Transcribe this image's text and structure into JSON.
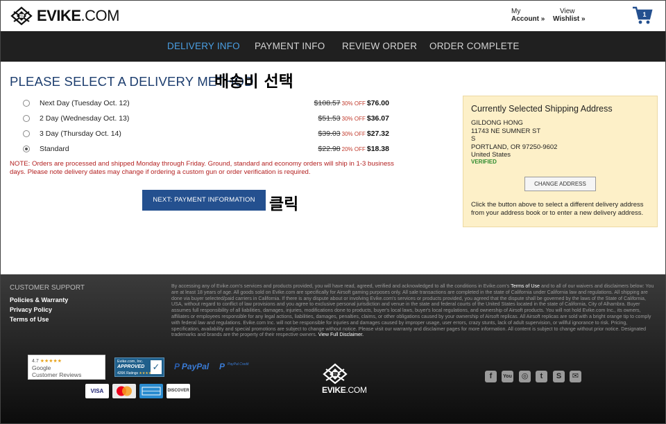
{
  "header": {
    "logo_text": "EVIKE",
    "logo_suffix": ".COM",
    "my_account_top": "My",
    "my_account_bottom": "Account »",
    "wishlist_top": "View",
    "wishlist_bottom": "Wishlist »",
    "cart_count": "1"
  },
  "nav": {
    "steps": [
      "DELIVERY INFO",
      "PAYMENT INFO",
      "REVIEW ORDER",
      "ORDER COMPLETE"
    ],
    "active_index": 0
  },
  "delivery": {
    "title": "PLEASE SELECT A DELIVERY METHOD",
    "korean_title": "배송비 선택",
    "options": [
      {
        "label": "Next Day (Tuesday Oct. 12)",
        "old_price": "$108.57",
        "discount": "30% OFF",
        "new_price": "$76.00",
        "selected": false
      },
      {
        "label": "2 Day (Wednesday Oct. 13)",
        "old_price": "$51.53",
        "discount": "30% OFF",
        "new_price": "$36.07",
        "selected": false
      },
      {
        "label": "3 Day (Thursday Oct. 14)",
        "old_price": "$39.03",
        "discount": "30% OFF",
        "new_price": "$27.32",
        "selected": false
      },
      {
        "label": "Standard",
        "old_price": "$22.98",
        "discount": "20% OFF",
        "new_price": "$18.38",
        "selected": true
      }
    ],
    "note": "NOTE: Orders are processed and shipped Monday through Friday. Ground, standard and economy orders will ship in 1-3 business days. Please note delivery dates may change if ordering a custom gun or order verification is required.",
    "next_button": "NEXT: PAYMENT INFORMATION",
    "korean_click": "클릭"
  },
  "address": {
    "title": "Currently Selected Shipping Address",
    "lines": [
      "GILDONG HONG",
      "11743 NE SUMNER ST",
      "S",
      "PORTLAND, OR 97250-9602",
      "United States"
    ],
    "status": "VERIFIED",
    "change_button": "CHANGE ADDRESS",
    "help": "Click the button above to select a different delivery address from your address book or to enter a new delivery address."
  },
  "footer": {
    "support_title": "CUSTOMER SUPPORT",
    "links": [
      "Policies & Warranty",
      "Privacy Policy",
      "Terms of Use"
    ],
    "legal_intro": "By accessing any of Evike.com's services and products provided, you will have read, agreed, verified and acknowledged to all the conditions in Evike.com's",
    "legal_terms": "Terms of Use",
    "legal_body": "and to all of our waivers and disclaimers below: You are at least 18 years of age. All goods sold on Evike.com are specifically for Airsoft gaming purposes only. All sale transactions are completed in the state of California under California law and regulations. All shipping are done via buyer selected/paid carriers in California. If there is any dispute about or involving Evike.com's services or products provided, you agreed that the dispute shall be governed by the laws of the State of California, USA, without regard to conflict of law provisions and you agree to exclusive personal jurisdiction and venue in the state and federal courts of the United States located in the state of California, City of Alhambra. Buyer assumes full responsibility of all liabilities, damages, injuries, modifications done to products, buyer's local laws, buyer's local regulations, and ownership of Airsoft products. You will not hold Evike.com Inc., its owners, affiliates or employees responsible for any legal actions, liabilities, damages, penalties, claims, or other obligations caused by your ownership of Airsoft replicas. All Airsoft replicas are sold with a bright orange tip to comply with federal law and regulations. Evike.com Inc. will not be responsible for injuries and damages caused by improper usage, user errors, crazy stunts, lack of adult supervision, or willful ignorance to risk. Pricing, specification, availability and special promotions are subject to change without notice. Please visit our warranty and disclaimer pages for more information. All content is subject to change without prior notice. Designated trademarks and brands are the property of their respective owners.",
    "legal_view": "View Full Disclaimer.",
    "google_rating": "4.7",
    "google_stars": "★★★★★",
    "google_line1": "Google",
    "google_line2": "Customer Reviews",
    "shopper_l1": "Evike.com, Inc.",
    "shopper_l2": "APPROVED",
    "shopper_l3": "426K Ratings",
    "shopper_stars": "★★★★★",
    "paypal": "PayPal",
    "paypal_credit": "PayPal Credit",
    "cards": [
      "VISA",
      "MC",
      "AMEX",
      "DISCOVER"
    ],
    "logo_text": "EVIKE",
    "logo_suffix": ".COM",
    "social": [
      "f",
      "You",
      "◎",
      "t",
      "S",
      "✉"
    ]
  }
}
